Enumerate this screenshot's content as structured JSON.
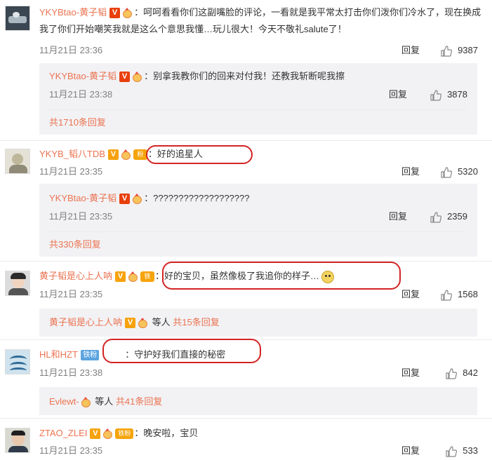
{
  "comments": [
    {
      "user": "YKYBtao-黄子韬",
      "text": "：呵呵看看你们这副嘴脸的评论，一看就是我平常太打击你们泼你们冷水了，现在换成我了你们开始嘲笑我就是这么个意思我懂…玩儿很大！今天不敬礼salute了！",
      "time": "11月21日 23:36",
      "reply": "回复",
      "likes": "9387",
      "sub": {
        "user": "YKYBtao-黄子韬",
        "text": "：别拿我教你们的回来对付我！还教我斩断呢我擦",
        "time": "11月21日 23:38",
        "reply": "回复",
        "likes": "3878",
        "more": "共1710条回复"
      }
    },
    {
      "user": "YKYB_韬八TDB",
      "fan": "粉",
      "text": "：好的追星人",
      "time": "11月21日 23:35",
      "reply": "回复",
      "likes": "5320",
      "sub": {
        "user": "YKYBtao-黄子韬",
        "text": "：???????????????????",
        "time": "11月21日 23:35",
        "reply": "回复",
        "likes": "2359",
        "more": "共330条回复"
      }
    },
    {
      "user": "黄子韬是心上人呐",
      "fan": "铁",
      "text": "：好的宝贝，虽然像极了我追你的样子…",
      "time": "11月21日 23:35",
      "reply": "回复",
      "likes": "1568",
      "sub": {
        "user": "黄子韬是心上人呐",
        "others": "等人",
        "more": "共15条回复"
      }
    },
    {
      "user": "HL和HZT",
      "fan": "铁粉",
      "text": "：守护好我们直接的秘密",
      "time": "11月21日 23:38",
      "reply": "回复",
      "likes": "842",
      "sub": {
        "user": "Evlewt-",
        "others": "等人",
        "more": "共41条回复"
      }
    },
    {
      "user": "ZTAO_ZLEI",
      "fan": "铁粉",
      "text": "：晚安啦，宝贝",
      "time": "11月21日 23:35",
      "reply": "回复",
      "likes": "533"
    }
  ],
  "badge_v": "V",
  "colors": {
    "username": "#eb7350",
    "highlight": "#d42424",
    "subbox": "#f2f2f5"
  }
}
